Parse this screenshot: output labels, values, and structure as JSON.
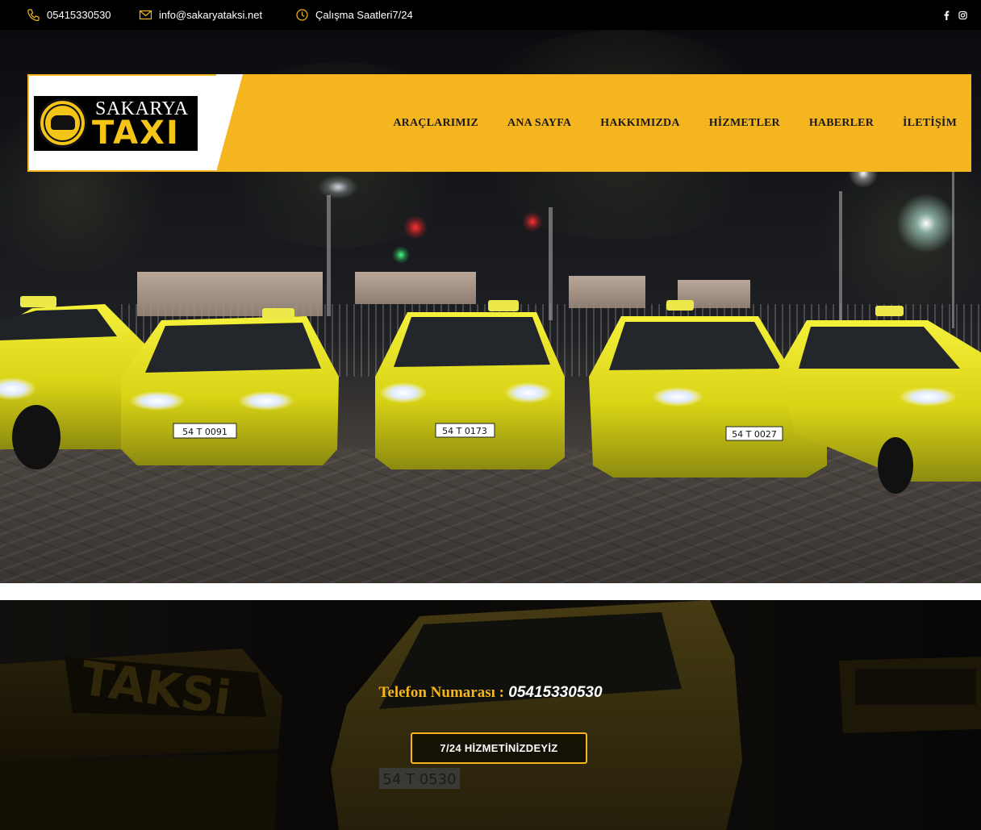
{
  "topbar": {
    "phone": "05415330530",
    "email": "info@sakaryataksi.net",
    "hours": "Çalışma Saatleri7/24",
    "socials": [
      "facebook-icon",
      "instagram-icon"
    ]
  },
  "logo": {
    "line1": "SAKARYA",
    "line2": "TAXI"
  },
  "nav": {
    "items": [
      "ARAÇLARIMIZ",
      "ANA SAYFA",
      "HAKKIMIZDA",
      "HİZMETLER",
      "HABERLER",
      "İLETİŞİM"
    ]
  },
  "hero": {
    "plates": [
      "54 T 0091",
      "54 T 0173",
      "54 T 0027"
    ]
  },
  "cta": {
    "phone_label": "Telefon Numarası :",
    "phone_number": "05415330530",
    "button_label": "7/24 HİZMETİNİZDEYİZ",
    "sign_text": "TAKSi",
    "plate": "54 T 0530"
  },
  "colors": {
    "accent": "#f4b51f",
    "topbar": "#000000",
    "nav_text": "#1b1b1b"
  }
}
